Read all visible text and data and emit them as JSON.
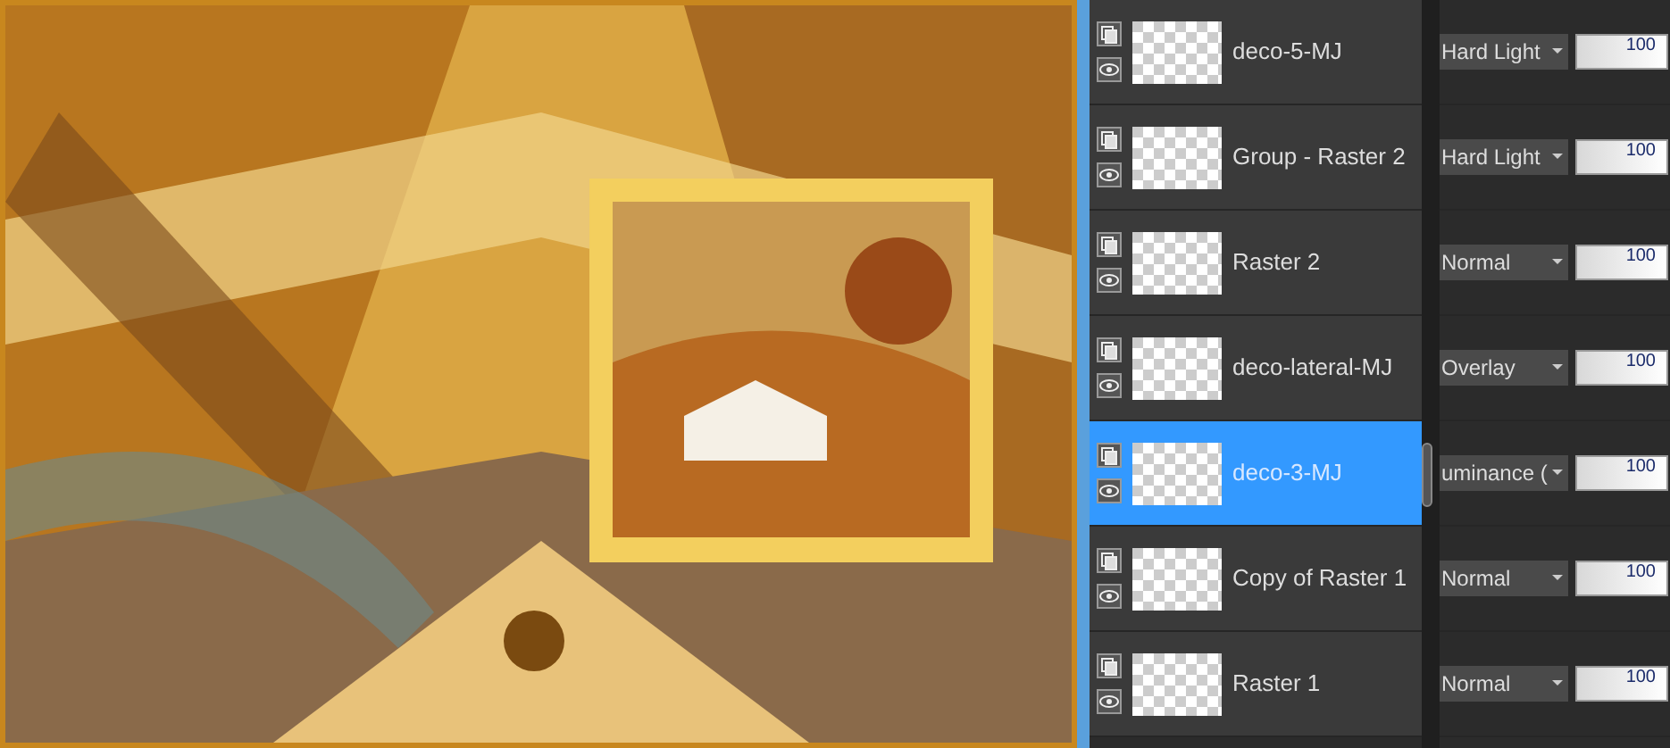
{
  "layers": [
    {
      "name": "deco-5-MJ",
      "blend_mode": "Hard Light",
      "opacity": "100",
      "selected": false
    },
    {
      "name": "Group - Raster 2",
      "blend_mode": "Hard Light",
      "opacity": "100",
      "selected": false
    },
    {
      "name": "Raster 2",
      "blend_mode": "Normal",
      "opacity": "100",
      "selected": false
    },
    {
      "name": "deco-lateral-MJ",
      "blend_mode": "Overlay",
      "opacity": "100",
      "selected": false
    },
    {
      "name": "deco-3-MJ",
      "blend_mode": "uminance (",
      "opacity": "100",
      "selected": true
    },
    {
      "name": "Copy of Raster 1",
      "blend_mode": "Normal",
      "opacity": "100",
      "selected": false
    },
    {
      "name": "Raster 1",
      "blend_mode": "Normal",
      "opacity": "100",
      "selected": false
    }
  ]
}
